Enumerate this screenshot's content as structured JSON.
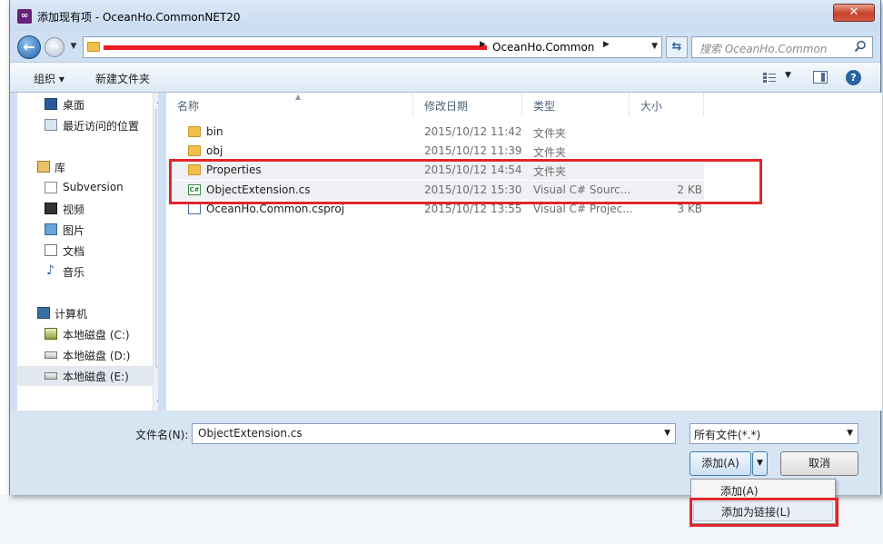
{
  "window": {
    "title": "添加现有项 - OceanHo.CommonNET20",
    "app_icon": "visual-studio-icon",
    "close_label": "✕"
  },
  "address": {
    "current_folder": "OceanHo.Common",
    "search_placeholder": "搜索 OceanHo.Common"
  },
  "toolbar": {
    "organize_label": "组织 ▾",
    "new_folder_label": "新建文件夹"
  },
  "nav": {
    "items": [
      {
        "label": "桌面",
        "icon": "desktop-icon"
      },
      {
        "label": "最近访问的位置",
        "icon": "recent-places-icon"
      },
      {
        "label": "库",
        "icon": "library-icon"
      },
      {
        "label": "Subversion",
        "icon": "subversion-icon"
      },
      {
        "label": "视频",
        "icon": "video-library-icon"
      },
      {
        "label": "图片",
        "icon": "pictures-library-icon"
      },
      {
        "label": "文档",
        "icon": "documents-library-icon"
      },
      {
        "label": "音乐",
        "icon": "music-library-icon"
      },
      {
        "label": "计算机",
        "icon": "computer-icon"
      },
      {
        "label": "本地磁盘 (C:)",
        "icon": "drive-c-icon"
      },
      {
        "label": "本地磁盘 (D:)",
        "icon": "drive-d-icon"
      },
      {
        "label": "本地磁盘 (E:)",
        "icon": "drive-e-icon",
        "selected": true
      }
    ]
  },
  "file_list": {
    "columns": [
      "名称",
      "修改日期",
      "类型",
      "大小"
    ],
    "rows": [
      {
        "name": "bin",
        "date": "2015/10/12 11:42",
        "type": "文件夹",
        "size": "",
        "icon": "folder-icon"
      },
      {
        "name": "obj",
        "date": "2015/10/12 11:39",
        "type": "文件夹",
        "size": "",
        "icon": "folder-icon"
      },
      {
        "name": "Properties",
        "date": "2015/10/12 14:54",
        "type": "文件夹",
        "size": "",
        "icon": "folder-icon"
      },
      {
        "name": "ObjectExtension.cs",
        "date": "2015/10/12 15:30",
        "type": "Visual C# Sourc...",
        "size": "2 KB",
        "icon": "csharp-file-icon"
      },
      {
        "name": "OceanHo.Common.csproj",
        "date": "2015/10/12 13:55",
        "type": "Visual C# Projec...",
        "size": "3 KB",
        "icon": "csproj-file-icon"
      }
    ]
  },
  "footer": {
    "filename_label": "文件名(N):",
    "filename_value": "ObjectExtension.cs",
    "filter_value": "所有文件(*.*)",
    "add_label": "添加(A)",
    "cancel_label": "取消"
  },
  "add_menu": {
    "items": [
      "添加(A)",
      "添加为链接(L)"
    ]
  },
  "colors": {
    "annotation_red": "#e0262c",
    "accent": "#3c7fb1"
  }
}
